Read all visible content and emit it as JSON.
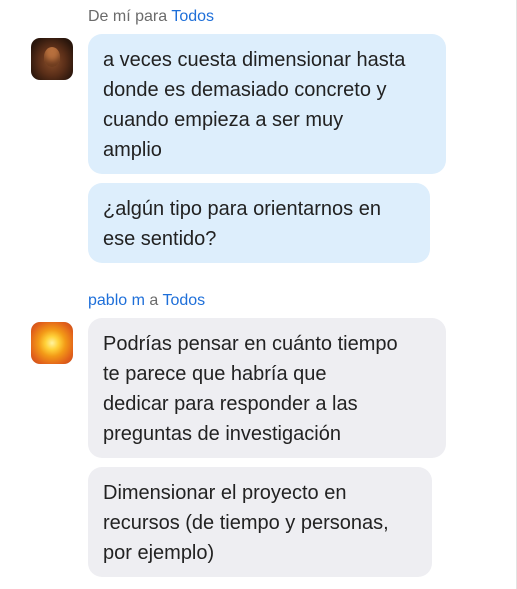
{
  "group1": {
    "sender": "De mí",
    "connector": "para",
    "recipient": "Todos",
    "messages": [
      {
        "lines": [
          "a veces cuesta dimensionar hasta",
          "donde es demasiado concreto y",
          "cuando empieza a ser muy",
          "amplio"
        ]
      },
      {
        "lines": [
          "¿algún tipo para orientarnos en",
          "ese sentido?"
        ]
      }
    ]
  },
  "group2": {
    "sender": "pablo m",
    "connector": "a",
    "recipient": "Todos",
    "messages": [
      {
        "lines": [
          "Podrías pensar en cuánto tiempo",
          "te parece que habría que",
          "dedicar para responder a las",
          "preguntas de investigación"
        ]
      },
      {
        "lines": [
          "Dimensionar el proyecto en",
          "recursos (de tiempo y personas,",
          "por ejemplo)"
        ]
      }
    ]
  }
}
